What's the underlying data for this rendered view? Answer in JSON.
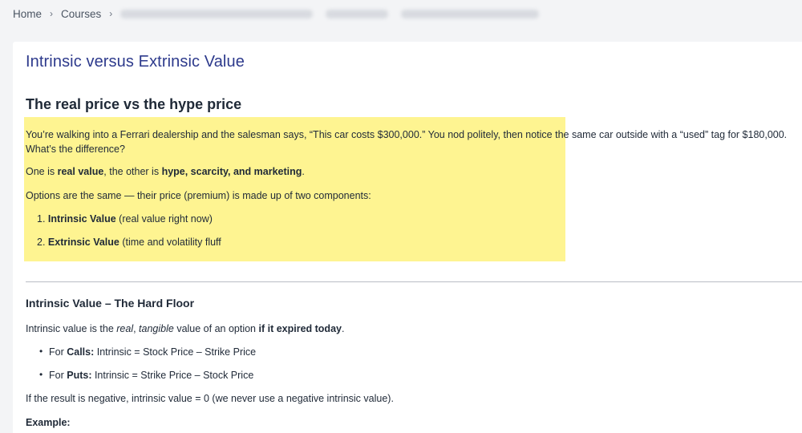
{
  "breadcrumb": {
    "home": "Home",
    "courses": "Courses"
  },
  "page": {
    "title": "Intrinsic versus Extrinsic Value"
  },
  "section1": {
    "heading": "The real price vs the hype price",
    "para1_line1": "You’re walking into a Ferrari dealership and the salesman says, “This car costs $300,000.” You nod politely, then notice the same car outside with a “used” tag for $180,000.",
    "para1_line2": "What’s the difference?",
    "para2_a": "One is ",
    "para2_b": "real value",
    "para2_c": ", the other is ",
    "para2_d": "hype, scarcity, and marketing",
    "para2_e": ".",
    "para3": "Options are the same — their price (premium) is made up of two components:",
    "list": [
      {
        "num": "1.",
        "bold": "Intrinsic Value",
        "rest": " (real value right now)"
      },
      {
        "num": "2.",
        "bold": "Extrinsic Value",
        "rest": " (time and volatility fluff"
      }
    ]
  },
  "section2": {
    "heading": "Intrinsic Value – The Hard Floor",
    "intro_a": "Intrinsic value is the ",
    "intro_b": "real",
    "intro_c": ", ",
    "intro_d": "tangible",
    "intro_e": " value of an option ",
    "intro_f": "if it expired today",
    "intro_g": ".",
    "bullets": [
      {
        "prefix": "For ",
        "bold": "Calls:",
        "rest": " Intrinsic = Stock Price – Strike Price"
      },
      {
        "prefix": "For ",
        "bold": "Puts:",
        "rest": " Intrinsic = Strike Price – Stock Price"
      }
    ],
    "negative_note": "If the result is negative, intrinsic value = 0 (we never use a negative intrinsic value).",
    "example_label": "Example:"
  }
}
